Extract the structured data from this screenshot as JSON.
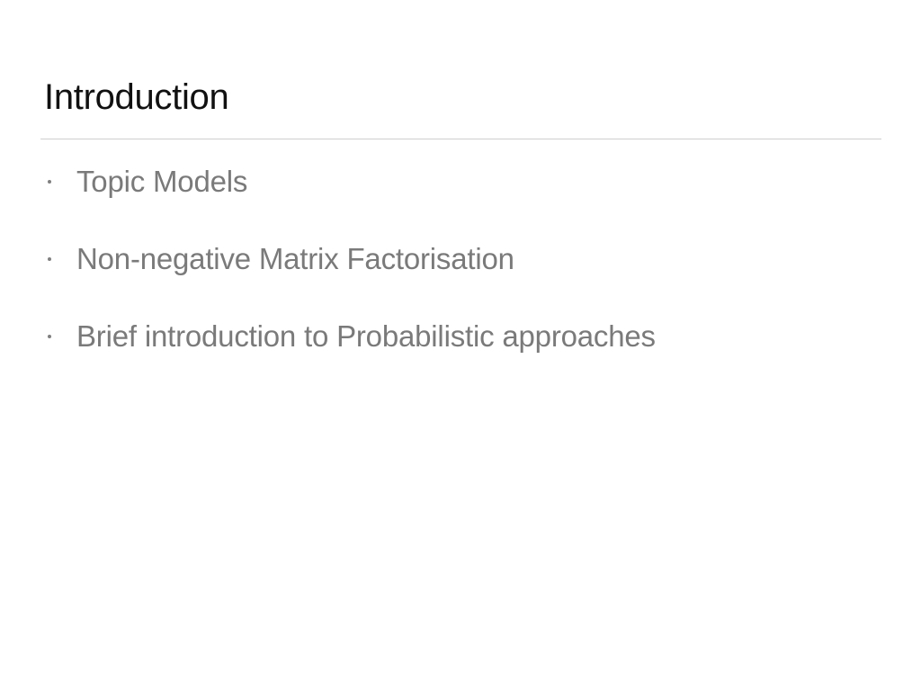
{
  "slide": {
    "title": "Introduction",
    "bullets": [
      "Topic Models",
      "Non-negative Matrix Factorisation",
      "Brief introduction to Probabilistic approaches"
    ]
  }
}
